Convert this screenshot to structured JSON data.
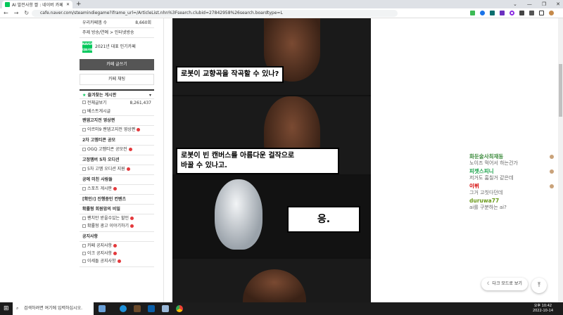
{
  "browser": {
    "tab_title": "AI 발전사항 짤 : 네이버 카페",
    "url": "cafe.naver.com/steamindiegame?iframe_url=/ArticleList.nhn%3Fsearch.clubid=27842958%26search.boardtype=L"
  },
  "sidebar": {
    "members_label": "우리카페앱 수",
    "members_count": "8,660회",
    "topic": "주제 방송/연예 > 인터넷방송",
    "badge_text": "NAVER 대표카페",
    "award": "2021년 대표 인기카페",
    "write_button": "카페 글쓰기",
    "chat_button": "카페 채팅",
    "favorites": "즐겨찾는 게시판",
    "all_posts": "전체글보기",
    "all_count": "8,261,437",
    "best": "베스트게시글",
    "groups": [
      {
        "title": "왠뎀고지전 영상편",
        "items": [
          "이르미9 왠뎀고지전 영상편"
        ]
      },
      {
        "title": "2차 고멤티콘 공모",
        "items": [
          "OGQ 고멤티콘 공모전"
        ]
      },
      {
        "title": "고정멤버 5차 오디션",
        "items": [
          "5차 고멤 오디션 지원"
        ]
      },
      {
        "title": "공예 미친 사람들",
        "items": [
          "스포츠 게시판"
        ]
      },
      {
        "title": "[확인!] 진행중인 컨텐츠",
        "items": []
      },
      {
        "title": "확률형 회원맘의 비밀",
        "items": [
          "팬치만 받을수있는 할인",
          "확률형 광고 이야기하기"
        ]
      },
      {
        "title": "공지사항",
        "items": [
          "카페 공지사항",
          "이크 공지사항",
          "이세돌 공지사항"
        ]
      }
    ]
  },
  "comic": {
    "caption1": "로봇이 교향곡을 작곡할 수 있나?",
    "caption2_line1": "로봇이 빈 캔버스를 아름다운 걸작으로",
    "caption2_line2": "바꿀 수 있나고.",
    "caption3": "응."
  },
  "chat": [
    {
      "name": "화둔술사최재동",
      "msg": "노이즈 먹어서 하는건가",
      "color": "#3d8b3d"
    },
    {
      "name": "피젯스피니",
      "msg": "저거도 훔칠거 같은데",
      "color": "#1aa34a"
    },
    {
      "name": "이뷔",
      "msg": "그거 고칫다던데",
      "color": "#d40000"
    },
    {
      "name": "duruwa77",
      "msg": "ai를 구분하는 ai?",
      "color": "#6a9a1a"
    }
  ],
  "buttons": {
    "dark_mode": "다크 모드로 보기",
    "top": "⤒"
  },
  "taskbar": {
    "search": "검색하려면 여기에 입력하십시오.",
    "time": "오후 10:42",
    "date": "2022-10-14"
  }
}
